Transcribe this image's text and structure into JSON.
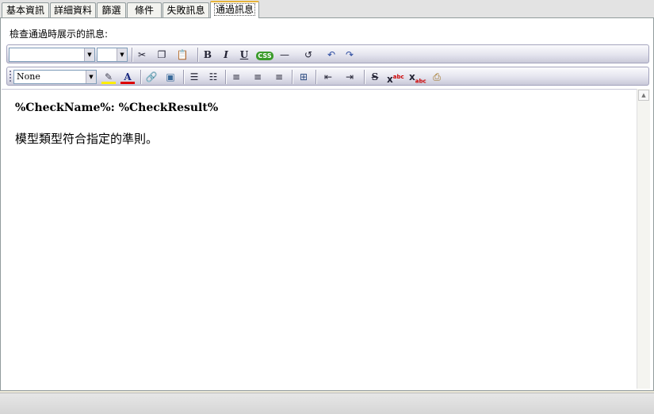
{
  "tabs": [
    {
      "label": "基本資訊"
    },
    {
      "label": "詳細資料"
    },
    {
      "label": "篩選"
    },
    {
      "label": "條件"
    },
    {
      "label": "失敗訊息"
    },
    {
      "label": "通過訊息"
    }
  ],
  "active_tab": "通過訊息",
  "caption": "檢查通過時展示的訊息:",
  "toolbar1": {
    "font_family_value": "",
    "font_size_value": "",
    "icons": [
      "cut-icon",
      "copy-icon",
      "paste-icon",
      "bold-icon",
      "italic-icon",
      "underline-icon",
      "css-icon",
      "horizontal-rule-icon",
      "refresh-icon",
      "undo-icon",
      "redo-icon"
    ],
    "bold_glyph": "B",
    "italic_glyph": "I",
    "underline_glyph": "U",
    "css_badge": "CSS"
  },
  "toolbar2": {
    "style_value": "None",
    "icons": [
      "highlight-icon",
      "font-color-icon",
      "insert-link-icon",
      "insert-image-icon",
      "numbered-list-icon",
      "bullet-list-icon",
      "align-left-icon",
      "align-center-icon",
      "align-right-icon",
      "insert-table-icon",
      "outdent-icon",
      "indent-icon",
      "strikethrough-icon",
      "superscript-icon",
      "subscript-icon",
      "print-icon"
    ],
    "font_color_glyph": "A",
    "strike_glyph": "S"
  },
  "editor": {
    "line1": "%CheckName%: %CheckResult%",
    "line2": "模型類型符合指定的準則。"
  },
  "colors": {
    "active_tab_accent": "#e6b43a",
    "toolbar_gradient_bottom": "#c9c9d9",
    "css_badge": "#3a9b2a",
    "font_color_underline": "#dd0000",
    "highlight_underline": "#ffee00"
  }
}
